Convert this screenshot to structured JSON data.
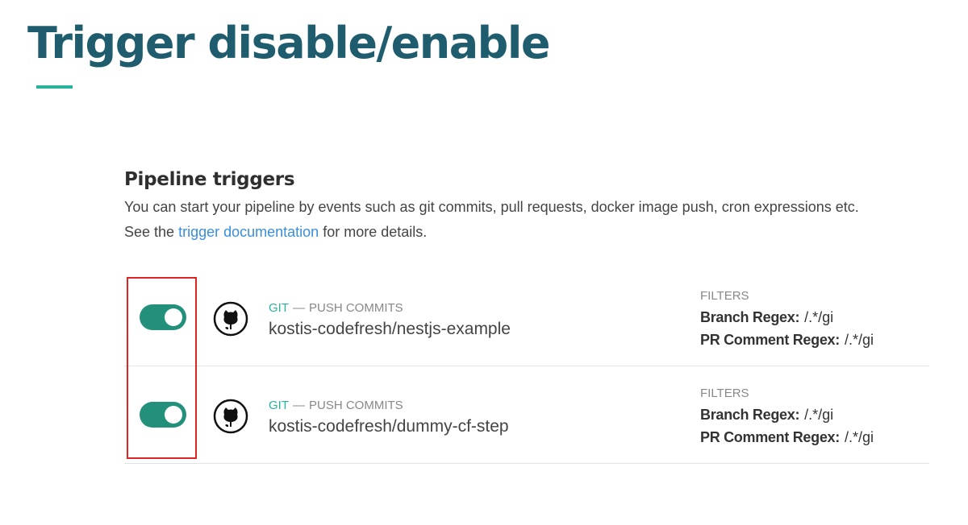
{
  "slide": {
    "title": "Trigger disable/enable",
    "accent_color": "#2ab39c",
    "title_color": "#1f5d6e"
  },
  "section": {
    "title": "Pipeline triggers",
    "description_line1": "You can start your pipeline by events such as git commits, pull requests, docker image push, cron expressions etc.",
    "description_prefix": "See the",
    "link_text": "trigger documentation",
    "description_suffix": "for more details."
  },
  "triggers": [
    {
      "enabled": true,
      "icon": "github-icon",
      "type": "GIT",
      "separator": "—",
      "event": "PUSH COMMITS",
      "repo": "kostis-codefresh/nestjs-example",
      "filters_title": "FILTERS",
      "branch_label": "Branch Regex:",
      "branch_value": "/.*/gi",
      "pr_label": "PR Comment Regex:",
      "pr_value": "/.*/gi"
    },
    {
      "enabled": true,
      "icon": "github-icon",
      "type": "GIT",
      "separator": "—",
      "event": "PUSH COMMITS",
      "repo": "kostis-codefresh/dummy-cf-step",
      "filters_title": "FILTERS",
      "branch_label": "Branch Regex:",
      "branch_value": "/.*/gi",
      "pr_label": "PR Comment Regex:",
      "pr_value": "/.*/gi"
    }
  ],
  "colors": {
    "toggle_on": "#23907c",
    "link": "#3b8ed8",
    "highlight": "#e02424"
  }
}
